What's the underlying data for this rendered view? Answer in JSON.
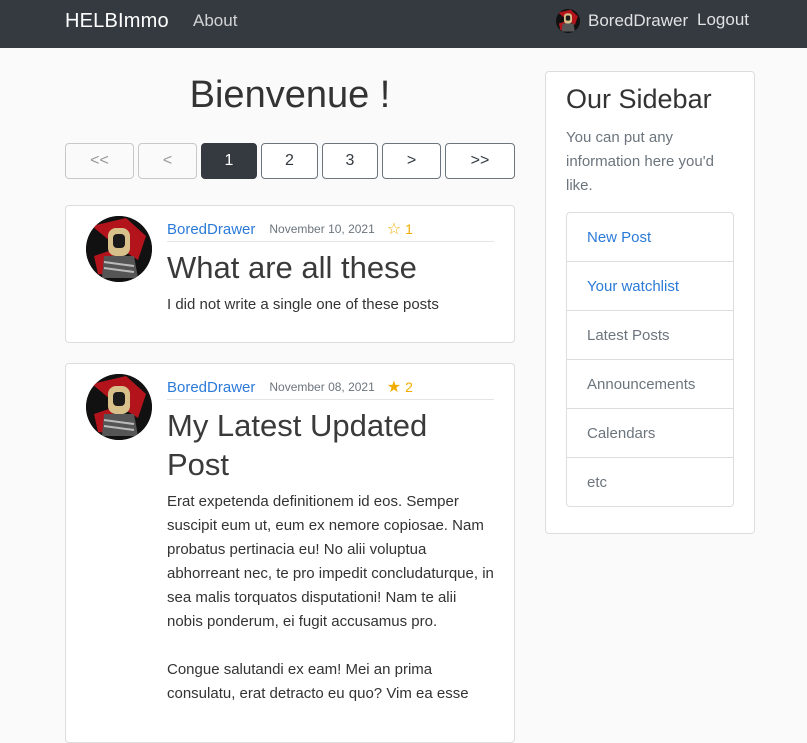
{
  "navbar": {
    "brand": "HELBImmo",
    "about": "About",
    "username": "BoredDrawer",
    "logout": "Logout"
  },
  "main": {
    "title": "Bienvenue !"
  },
  "pagination": {
    "first": "<<",
    "prev": "<",
    "pages": [
      "1",
      "2",
      "3"
    ],
    "active_page": "1",
    "next": ">",
    "last": ">>"
  },
  "posts": [
    {
      "author": "BoredDrawer",
      "date": "November 10, 2021",
      "star": "☆",
      "star_icon": "star-outline-icon",
      "likes": "1",
      "title": "What are all these",
      "paragraphs": [
        "I did not write a single one of these posts"
      ]
    },
    {
      "author": "BoredDrawer",
      "date": "November 08, 2021",
      "star": "★",
      "star_icon": "star-filled-icon",
      "likes": "2",
      "title": "My Latest Updated Post",
      "paragraphs": [
        "Erat expetenda definitionem id eos. Semper suscipit eum ut, eum ex nemore copiosae. Nam probatus pertinacia eu! No alii voluptua abhorreant nec, te pro impedit concludaturque, in sea malis torquatos disputationi! Nam te alii nobis ponderum, ei fugit accusamus pro.",
        "Congue salutandi ex eam! Mei an prima consulatu, erat detracto eu quo? Vim ea esse"
      ]
    }
  ],
  "sidebar": {
    "title": "Our Sidebar",
    "text": "You can put any information here you'd like.",
    "items": [
      {
        "label": "New Post"
      },
      {
        "label": "Your watchlist"
      },
      {
        "label": "Latest Posts"
      },
      {
        "label": "Announcements"
      },
      {
        "label": "Calendars"
      },
      {
        "label": "etc"
      }
    ]
  },
  "colors": {
    "navbar_bg": "#343a40",
    "link": "#2b7ad8",
    "star": "#f0ad00"
  }
}
